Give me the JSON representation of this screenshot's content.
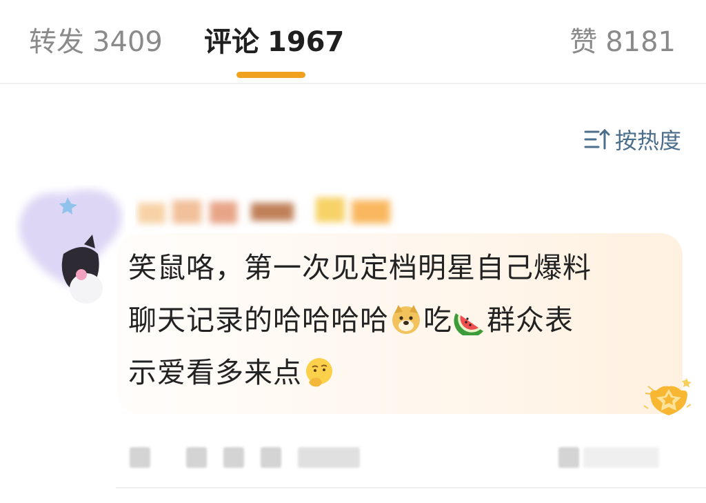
{
  "tabs": {
    "repost": {
      "label": "转发",
      "count": "3409"
    },
    "comments": {
      "label": "评论",
      "count": "1967"
    },
    "likes": {
      "label": "赞",
      "count": "8181"
    }
  },
  "sort": {
    "label": "按热度",
    "icon": "sort-icon"
  },
  "comment": {
    "text_line1": "笑鼠咯，第一次见定档明星自己爆料",
    "text_line2_a": "聊天记录的哈哈哈哈",
    "text_line2_b": "吃",
    "text_line2_c": "群众表",
    "text_line3": "示爱看多来点",
    "emojis": [
      "doge-icon",
      "watermelon-icon",
      "thinking-face-icon"
    ],
    "badge": "medal-icon"
  },
  "colors": {
    "accent": "#f0a21e",
    "sort_text": "#4a6e8c",
    "inactive_tab": "#8a8a8a"
  }
}
